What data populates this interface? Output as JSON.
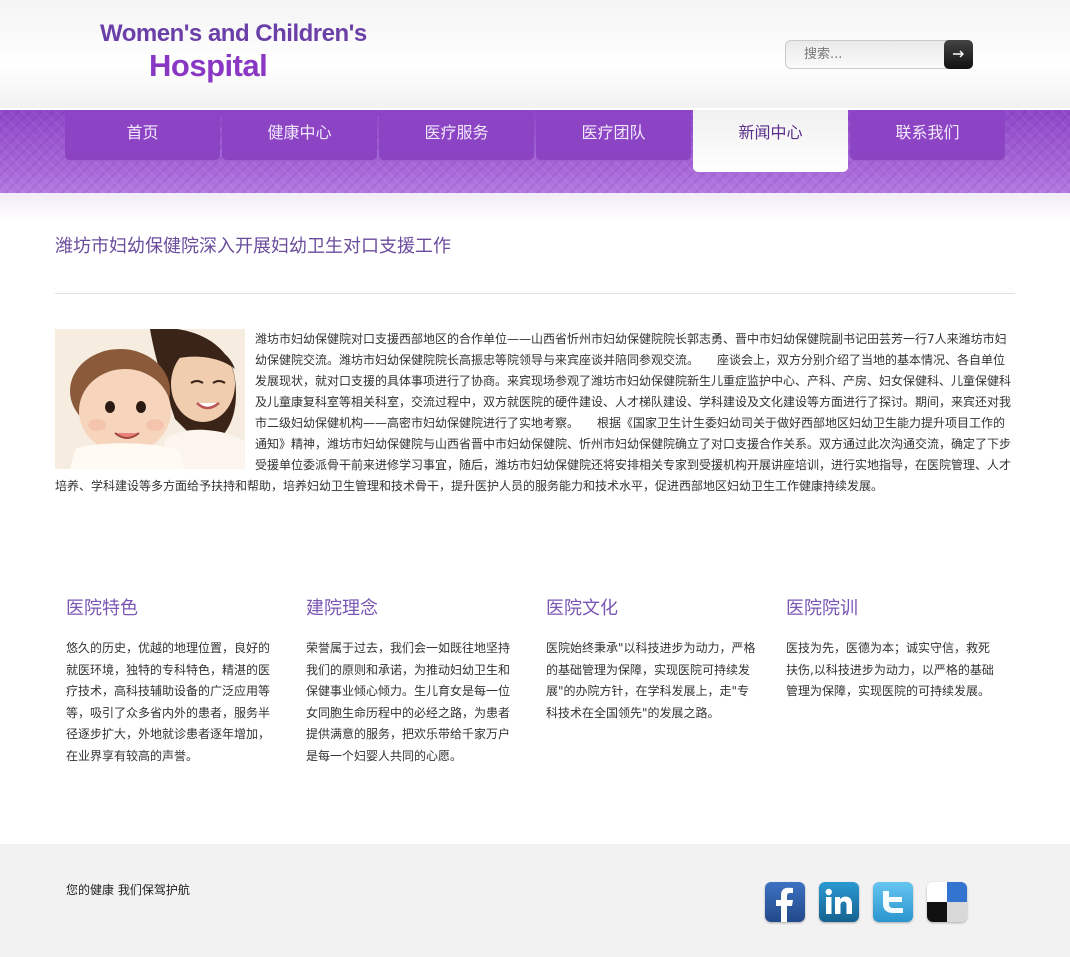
{
  "header": {
    "logo_line1": "Women's and Children's",
    "logo_line2": "Hospital",
    "search_placeholder": "搜索...",
    "search_button_icon": "arrow-right-icon"
  },
  "nav": {
    "items": [
      {
        "label": "首页",
        "active": false
      },
      {
        "label": "健康中心",
        "active": false
      },
      {
        "label": "医疗服务",
        "active": false
      },
      {
        "label": "医疗团队",
        "active": false
      },
      {
        "label": "新闻中心",
        "active": true
      },
      {
        "label": "联系我们",
        "active": false
      }
    ]
  },
  "article": {
    "title": "潍坊市妇幼保健院深入开展妇幼卫生对口支援工作",
    "image_description": "mother-and-baby-photo",
    "body": "潍坊市妇幼保健院对口支援西部地区的合作单位——山西省忻州市妇幼保健院院长郭志勇、晋中市妇幼保健院副书记田芸芳一行7人来潍坊市妇幼保健院交流。潍坊市妇幼保健院院长高振忠等院领导与来宾座谈并陪同参观交流。　　座谈会上，双方分别介绍了当地的基本情况、各自单位发展现状，就对口支援的具体事项进行了协商。来宾现场参观了潍坊市妇幼保健院新生儿重症监护中心、产科、产房、妇女保健科、儿童保健科及儿童康复科室等相关科室，交流过程中，双方就医院的硬件建设、人才梯队建设、学科建设及文化建设等方面进行了探讨。期间，来宾还对我市二级妇幼保健机构——高密市妇幼保健院进行了实地考察。　　根据《国家卫生计生委妇幼司关于做好西部地区妇幼卫生能力提升项目工作的通知》精神，潍坊市妇幼保健院与山西省晋中市妇幼保健院、忻州市妇幼保健院确立了对口支援合作关系。双方通过此次沟通交流，确定了下步受援单位委派骨干前来进修学习事宜，随后，潍坊市妇幼保健院还将安排相关专家到受援机构开展讲座培训，进行实地指导，在医院管理、人才培养、学科建设等多方面给予扶持和帮助，培养妇幼卫生管理和技术骨干，提升医护人员的服务能力和技术水平，促进西部地区妇幼卫生工作健康持续发展。"
  },
  "features": [
    {
      "title": "医院特色",
      "text": "悠久的历史，优越的地理位置，良好的就医环境，独特的专科特色，精湛的医疗技术，高科技辅助设备的广泛应用等等，吸引了众多省内外的患者，服务半径逐步扩大，外地就诊患者逐年增加，在业界享有较高的声誉。"
    },
    {
      "title": "建院理念",
      "text": "荣誉属于过去，我们会一如既往地坚持我们的原则和承诺，为推动妇幼卫生和保健事业倾心倾力。生儿育女是每一位女同胞生命历程中的必经之路，为患者提供满意的服务，把欢乐带给千家万户是每一个妇婴人共同的心愿。"
    },
    {
      "title": "医院文化",
      "text": "医院始终秉承\"以科技进步为动力，严格的基础管理为保障，实现医院可持续发展\"的办院方针，在学科发展上，走\"专科技术在全国领先\"的发展之路。"
    },
    {
      "title": "医院院训",
      "text": "医技为先，医德为本；诚实守信，救死扶伤,以科技进步为动力，以严格的基础管理为保障，实现医院的可持续发展。"
    }
  ],
  "footer": {
    "tagline": "您的健康 我们保驾护航",
    "social": [
      {
        "icon": "facebook-icon",
        "color": "#2f5fa8"
      },
      {
        "icon": "linkedin-icon",
        "color": "#1b86bd"
      },
      {
        "icon": "twitter-icon",
        "color": "#39a9e0"
      },
      {
        "icon": "delicious-icon",
        "color": "#111111"
      }
    ]
  }
}
